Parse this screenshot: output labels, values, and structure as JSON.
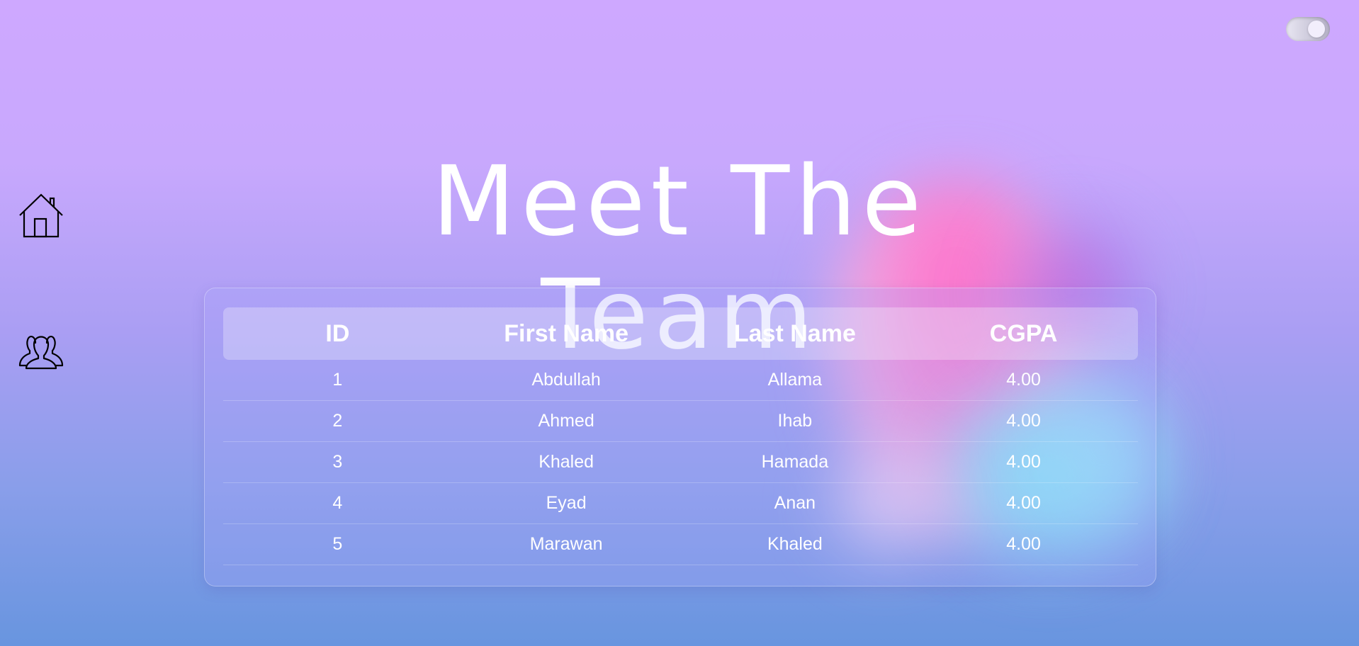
{
  "header": {
    "title": "Meet The Team"
  },
  "theme_toggle": {
    "state": "on"
  },
  "nav": {
    "items": [
      {
        "icon": "home-icon"
      },
      {
        "icon": "team-icon"
      }
    ]
  },
  "colors": {
    "background_top": "#cea8ff",
    "background_bottom": "#6895df",
    "text": "#ffffff",
    "accent_pink": "#ff6fcb",
    "accent_cyan": "#80f1f5"
  },
  "table": {
    "columns": [
      "ID",
      "First Name",
      "Last Name",
      "CGPA"
    ],
    "rows": [
      [
        "1",
        "Abdullah",
        "Allama",
        "4.00"
      ],
      [
        "2",
        "Ahmed",
        "Ihab",
        "4.00"
      ],
      [
        "3",
        "Khaled",
        "Hamada",
        "4.00"
      ],
      [
        "4",
        "Eyad",
        "Anan",
        "4.00"
      ],
      [
        "5",
        "Marawan",
        "Khaled",
        "4.00"
      ]
    ]
  }
}
